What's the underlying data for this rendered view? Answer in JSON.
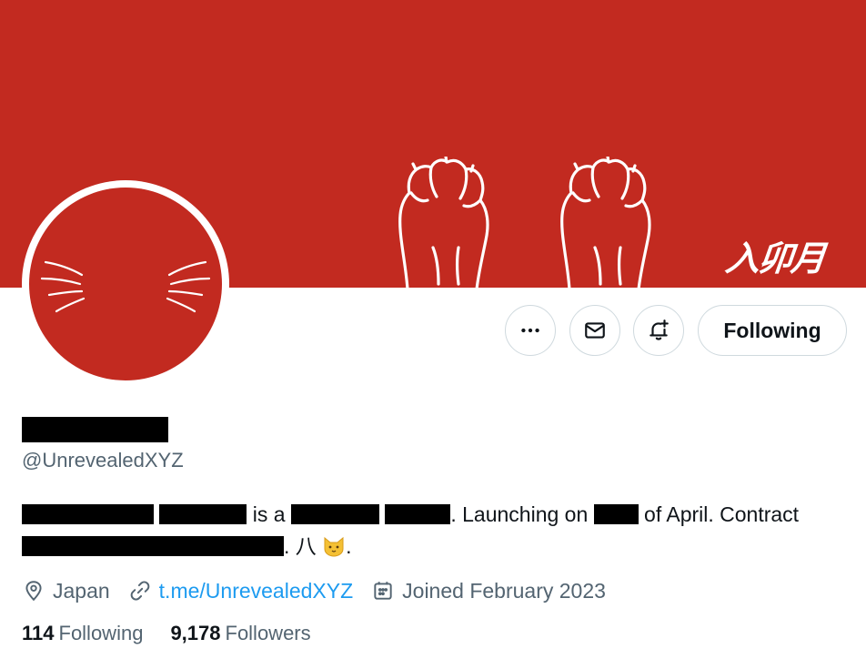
{
  "banner": {
    "color": "#c22a20",
    "kanji_text": "入卯月"
  },
  "avatar": {
    "color": "#c22a20"
  },
  "actions": {
    "more_icon": "more-dots-icon",
    "message_icon": "envelope-icon",
    "notify_icon": "bell-plus-icon",
    "following_label": "Following"
  },
  "profile": {
    "handle": "@UnrevealedXYZ"
  },
  "bio": {
    "text_is_a": "is a",
    "text_launching": ". Launching on",
    "text_of_april": "of April. Contract",
    "text_tail": ". 八",
    "text_end": "."
  },
  "meta": {
    "location": "Japan",
    "link": "t.me/UnrevealedXYZ",
    "joined": "Joined February 2023",
    "link_color": "#1d9bf0"
  },
  "stats": {
    "following_count": "114",
    "following_label": "Following",
    "followers_count": "9,178",
    "followers_label": "Followers"
  }
}
